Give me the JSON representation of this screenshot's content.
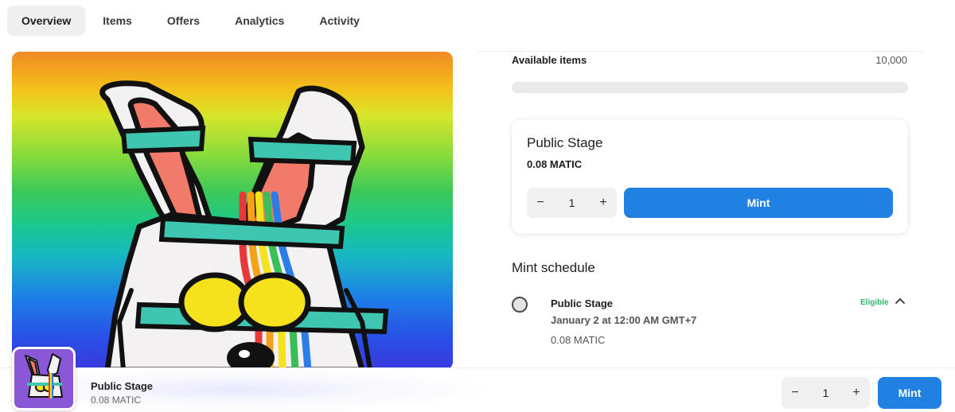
{
  "tabs": [
    {
      "label": "Overview",
      "active": true
    },
    {
      "label": "Items",
      "active": false
    },
    {
      "label": "Offers",
      "active": false
    },
    {
      "label": "Analytics",
      "active": false
    },
    {
      "label": "Activity",
      "active": false
    }
  ],
  "supply": {
    "label": "Available items",
    "value": "10,000",
    "progress_fraction": 0
  },
  "stage_card": {
    "title": "Public Stage",
    "price": "0.08 MATIC",
    "quantity": "1",
    "minus": "−",
    "plus": "+",
    "mint_label": "Mint"
  },
  "schedule": {
    "title": "Mint schedule",
    "items": [
      {
        "name": "Public Stage",
        "date": "January 2 at 12:00 AM GMT+7",
        "price": "0.08 MATIC",
        "status": "Eligible",
        "expanded": true
      }
    ]
  },
  "bottom_bar": {
    "name": "Public Stage",
    "price": "0.08 MATIC",
    "quantity": "1",
    "minus": "−",
    "plus": "+",
    "mint_label": "Mint"
  },
  "colors": {
    "accent": "#2081e2",
    "eligible": "#30b86a",
    "thumb_bg": "#8a58d6"
  },
  "icons": {
    "collapse": "chevron-up-icon",
    "minus": "minus-icon",
    "plus": "plus-icon"
  }
}
